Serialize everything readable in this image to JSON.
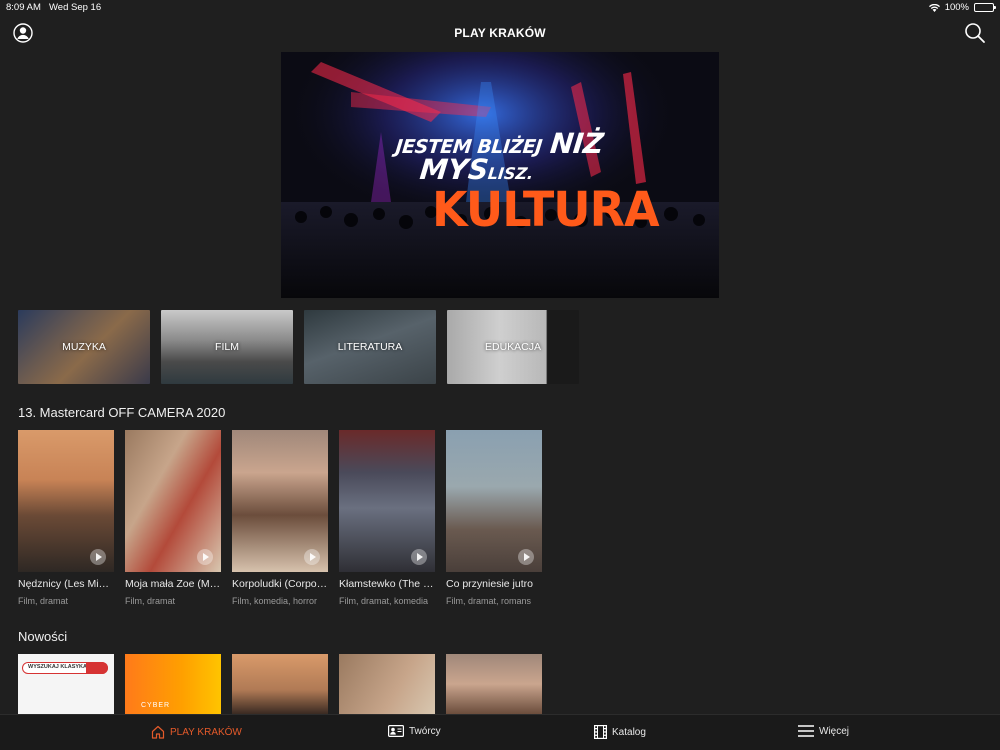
{
  "status_bar": {
    "time": "8:09 AM",
    "date": "Wed Sep 16",
    "battery": "100%"
  },
  "header": {
    "title": "PLAY KRAKÓW"
  },
  "hero": {
    "line1": "JESTEM BLIŻEJ",
    "line1b": "NIŻ",
    "line2": "MYS",
    "line2b": "LISZ.",
    "line3": "KULTURA"
  },
  "categories": [
    {
      "label": "MUZYKA"
    },
    {
      "label": "FILM"
    },
    {
      "label": "LITERATURA"
    },
    {
      "label": "EDUKACJA"
    }
  ],
  "section1": {
    "title": "13. Mastercard OFF CAMERA 2020",
    "items": [
      {
        "title": "Nędznicy (Les Misérables)",
        "genre": "Film, dramat"
      },
      {
        "title": "Moja mała Zoe (My Zoe)",
        "genre": "Film, dramat"
      },
      {
        "title": "Korpoludki (Corporate Animals)",
        "genre": "Film, komedia, horror"
      },
      {
        "title": "Kłamstewko (The Farewell)",
        "genre": "Film, dramat, komedia"
      },
      {
        "title": "Co przyniesie jutro",
        "genre": "Film, dramat, romans"
      }
    ]
  },
  "section2": {
    "title": "Nowości",
    "search_tile": "WYSZUKAJ KLASYKA",
    "cyber_tile": "CYBER"
  },
  "tabbar": {
    "home": "PLAY KRAKÓW",
    "tworcy": "Twórcy",
    "katalog": "Katalog",
    "wiecej": "Więcej"
  },
  "colors": {
    "accent": "#e45a2a",
    "hero_orange": "#ff5a1a",
    "background": "#1f1f1f"
  }
}
